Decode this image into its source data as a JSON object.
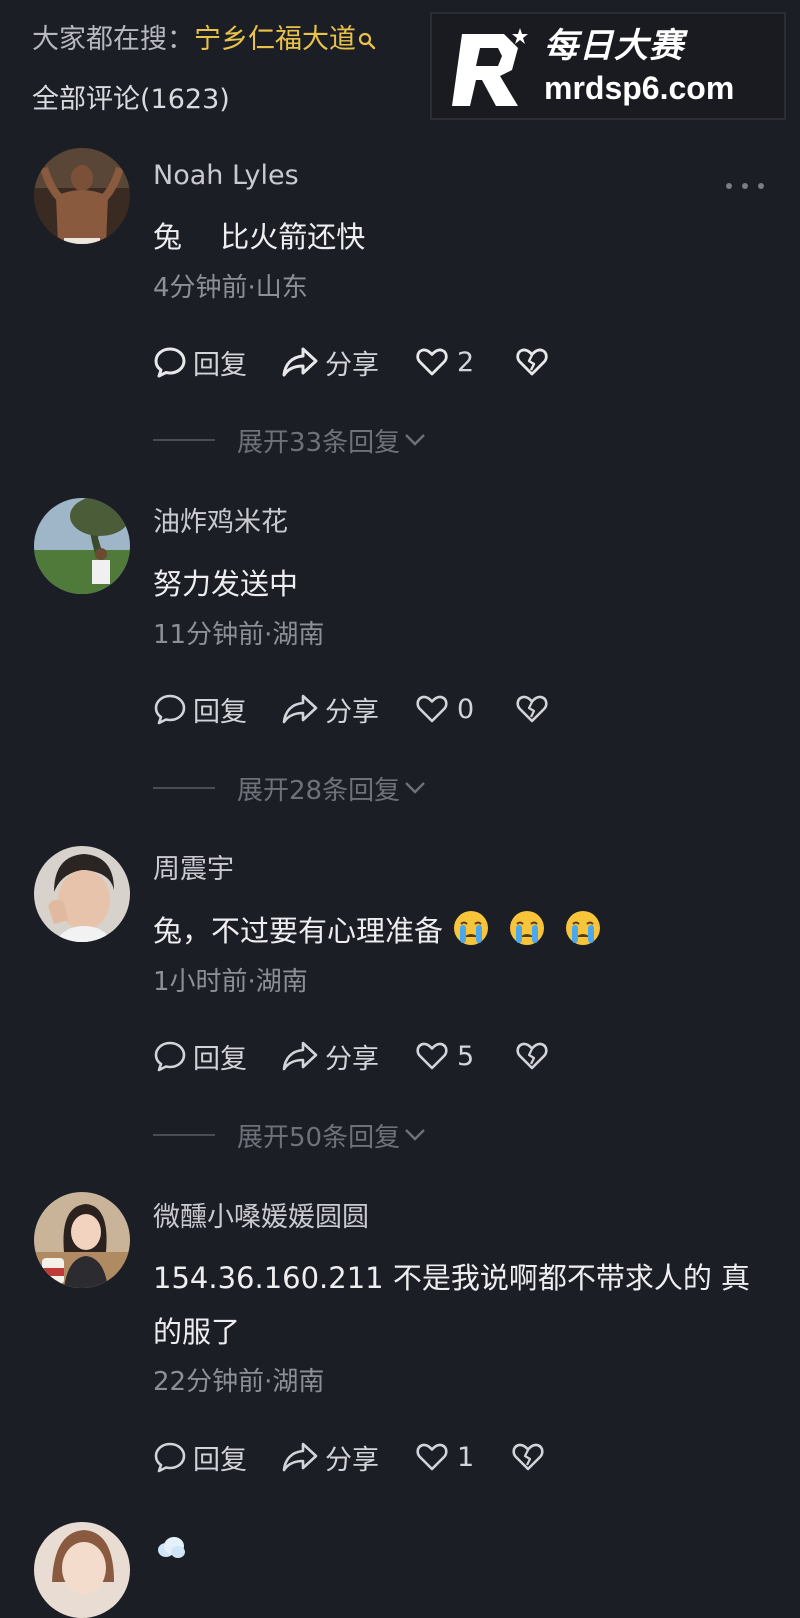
{
  "header": {
    "search_prefix": "大家都在搜：",
    "search_keyword": "宁乡仁福大道",
    "comment_count_label": "全部评论(1623)"
  },
  "watermark": {
    "title": "每日大赛",
    "url": "mrdsp6.com",
    "logo_letter": "R"
  },
  "comments": [
    {
      "username": "Noah Lyles",
      "text": "兔　 比火箭还快",
      "meta": "4分钟前·山东",
      "reply_label": "回复",
      "share_label": "分享",
      "likes": "2",
      "expand_label": "展开33条回复"
    },
    {
      "username": "油炸鸡米花",
      "text": "努力发送中",
      "meta": "11分钟前·湖南",
      "reply_label": "回复",
      "share_label": "分享",
      "likes": "0",
      "expand_label": "展开28条回复"
    },
    {
      "username": "周震宇",
      "text": "兔，不过要有心理准备",
      "emoji_count": 3,
      "emoji": "crying-face",
      "meta": "1小时前·湖南",
      "reply_label": "回复",
      "share_label": "分享",
      "likes": "5",
      "expand_label": "展开50条回复"
    },
    {
      "username": "微醺小嗓媛媛圆圆",
      "text": "154.36.160.211 不是我说啊都不带求人的 真的服了",
      "meta": "22分钟前·湖南",
      "reply_label": "回复",
      "share_label": "分享",
      "likes": "1"
    }
  ],
  "colors": {
    "background": "#1c1e26",
    "keyword": "#e9c24a",
    "muted": "#8d8f97"
  }
}
